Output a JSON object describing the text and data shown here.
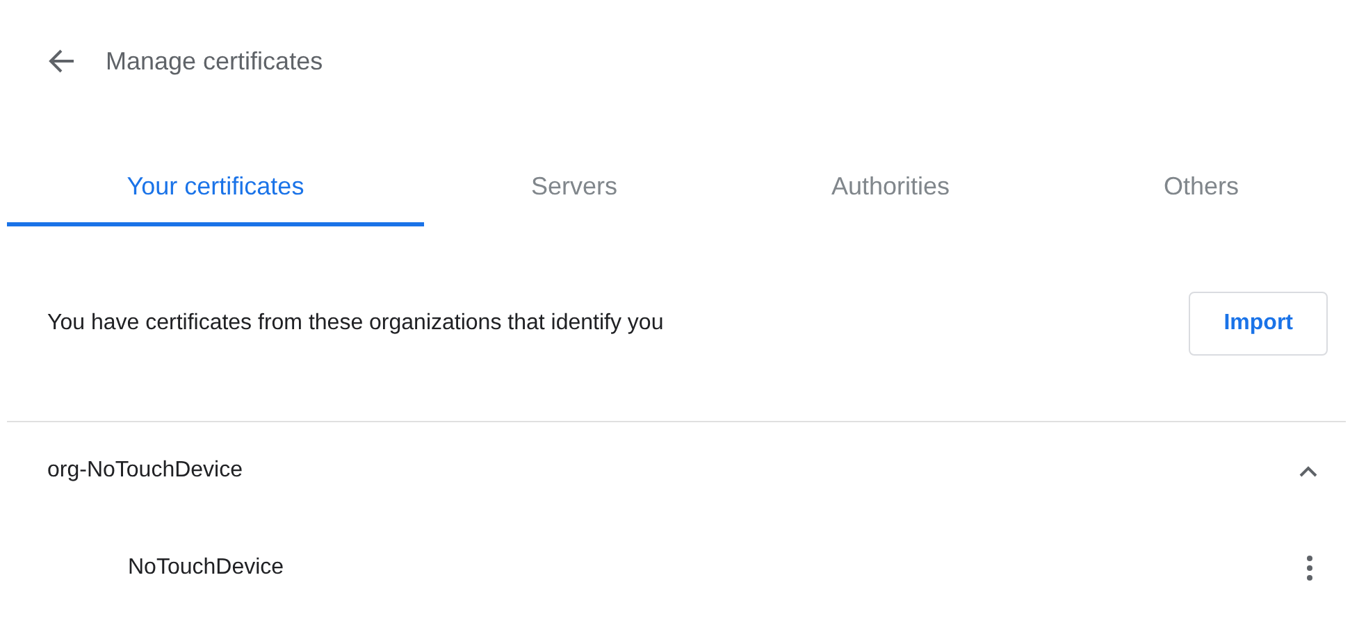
{
  "header": {
    "title": "Manage certificates"
  },
  "tabs": [
    {
      "label": "Your certificates",
      "selected": true
    },
    {
      "label": "Servers",
      "selected": false
    },
    {
      "label": "Authorities",
      "selected": false
    },
    {
      "label": "Others",
      "selected": false
    }
  ],
  "description": "You have certificates from these organizations that identify you",
  "import_button": "Import",
  "organizations": [
    {
      "name": "org-NoTouchDevice",
      "expanded": true,
      "children": [
        {
          "name": "NoTouchDevice"
        }
      ]
    }
  ]
}
